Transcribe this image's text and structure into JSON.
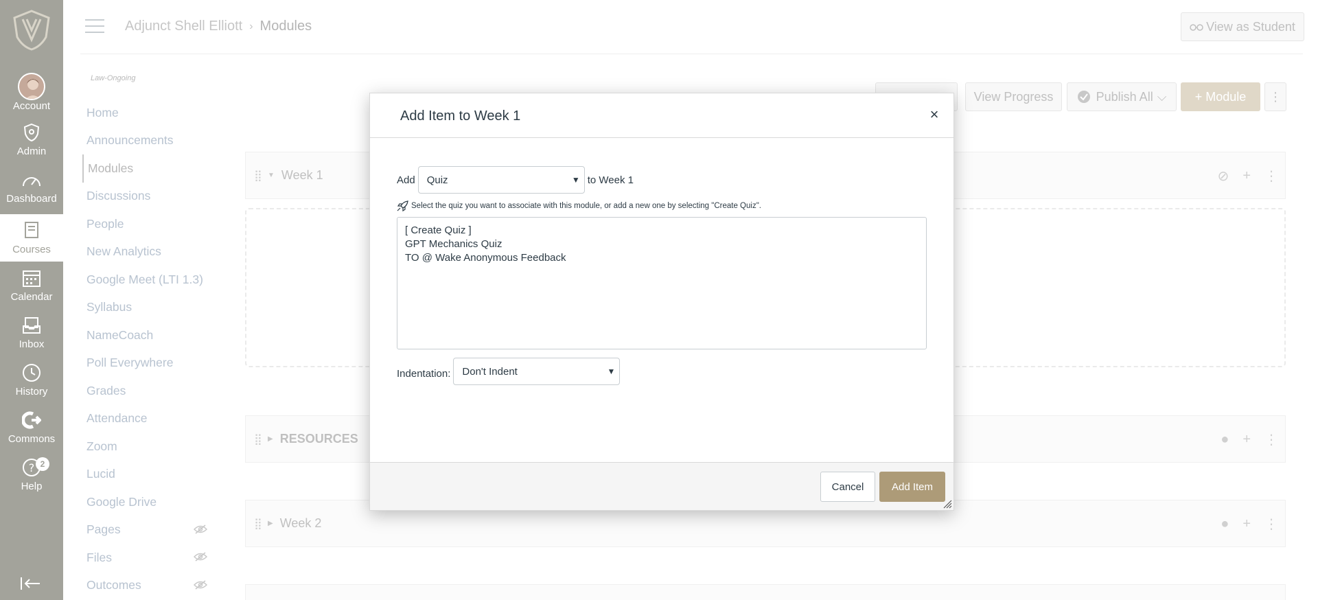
{
  "global_nav": {
    "items": [
      {
        "label": "Account",
        "icon": "avatar"
      },
      {
        "label": "Admin",
        "icon": "shield-icon"
      },
      {
        "label": "Dashboard",
        "icon": "dashboard-icon"
      },
      {
        "label": "Courses",
        "icon": "book-icon"
      },
      {
        "label": "Calendar",
        "icon": "calendar-icon"
      },
      {
        "label": "Inbox",
        "icon": "inbox-icon"
      },
      {
        "label": "History",
        "icon": "clock-icon"
      },
      {
        "label": "Commons",
        "icon": "commons-icon"
      },
      {
        "label": "Help",
        "icon": "help-icon",
        "badge": "2"
      }
    ]
  },
  "header": {
    "breadcrumb": [
      "Adjunct Shell Elliott",
      "Modules"
    ],
    "view_as_student": "View as Student"
  },
  "course_nav": {
    "subaccount": "Law-Ongoing",
    "items": [
      {
        "label": "Home"
      },
      {
        "label": "Announcements"
      },
      {
        "label": "Modules"
      },
      {
        "label": "Discussions"
      },
      {
        "label": "People"
      },
      {
        "label": "New Analytics"
      },
      {
        "label": "Google Meet (LTI 1.3)"
      },
      {
        "label": "Syllabus"
      },
      {
        "label": "NameCoach"
      },
      {
        "label": "Poll Everywhere"
      },
      {
        "label": "Grades"
      },
      {
        "label": "Attendance"
      },
      {
        "label": "Zoom"
      },
      {
        "label": "Lucid"
      },
      {
        "label": "Google Drive"
      },
      {
        "label": "Pages",
        "hidden": true
      },
      {
        "label": "Files",
        "hidden": true
      },
      {
        "label": "Outcomes",
        "hidden": true
      }
    ]
  },
  "toolbar": {
    "view_progress": "View Progress",
    "publish_all": "Publish All",
    "add_module": "+ Module"
  },
  "modules": [
    {
      "title": "Week 1"
    },
    {
      "title": "RESOURCES"
    },
    {
      "title": "Week 2"
    }
  ],
  "dialog": {
    "title": "Add Item to Week 1",
    "add_label": "Add",
    "type_value": "Quiz",
    "to_label": "to Week 1",
    "hint": "Select the quiz you want to associate with this module, or add a new one by selecting \"Create Quiz\".",
    "options": [
      "[ Create Quiz ]",
      "GPT Mechanics Quiz",
      "TO @ Wake Anonymous Feedback"
    ],
    "indentation_label": "Indentation:",
    "indentation_value": "Don't Indent",
    "cancel": "Cancel",
    "add_item": "Add Item"
  }
}
